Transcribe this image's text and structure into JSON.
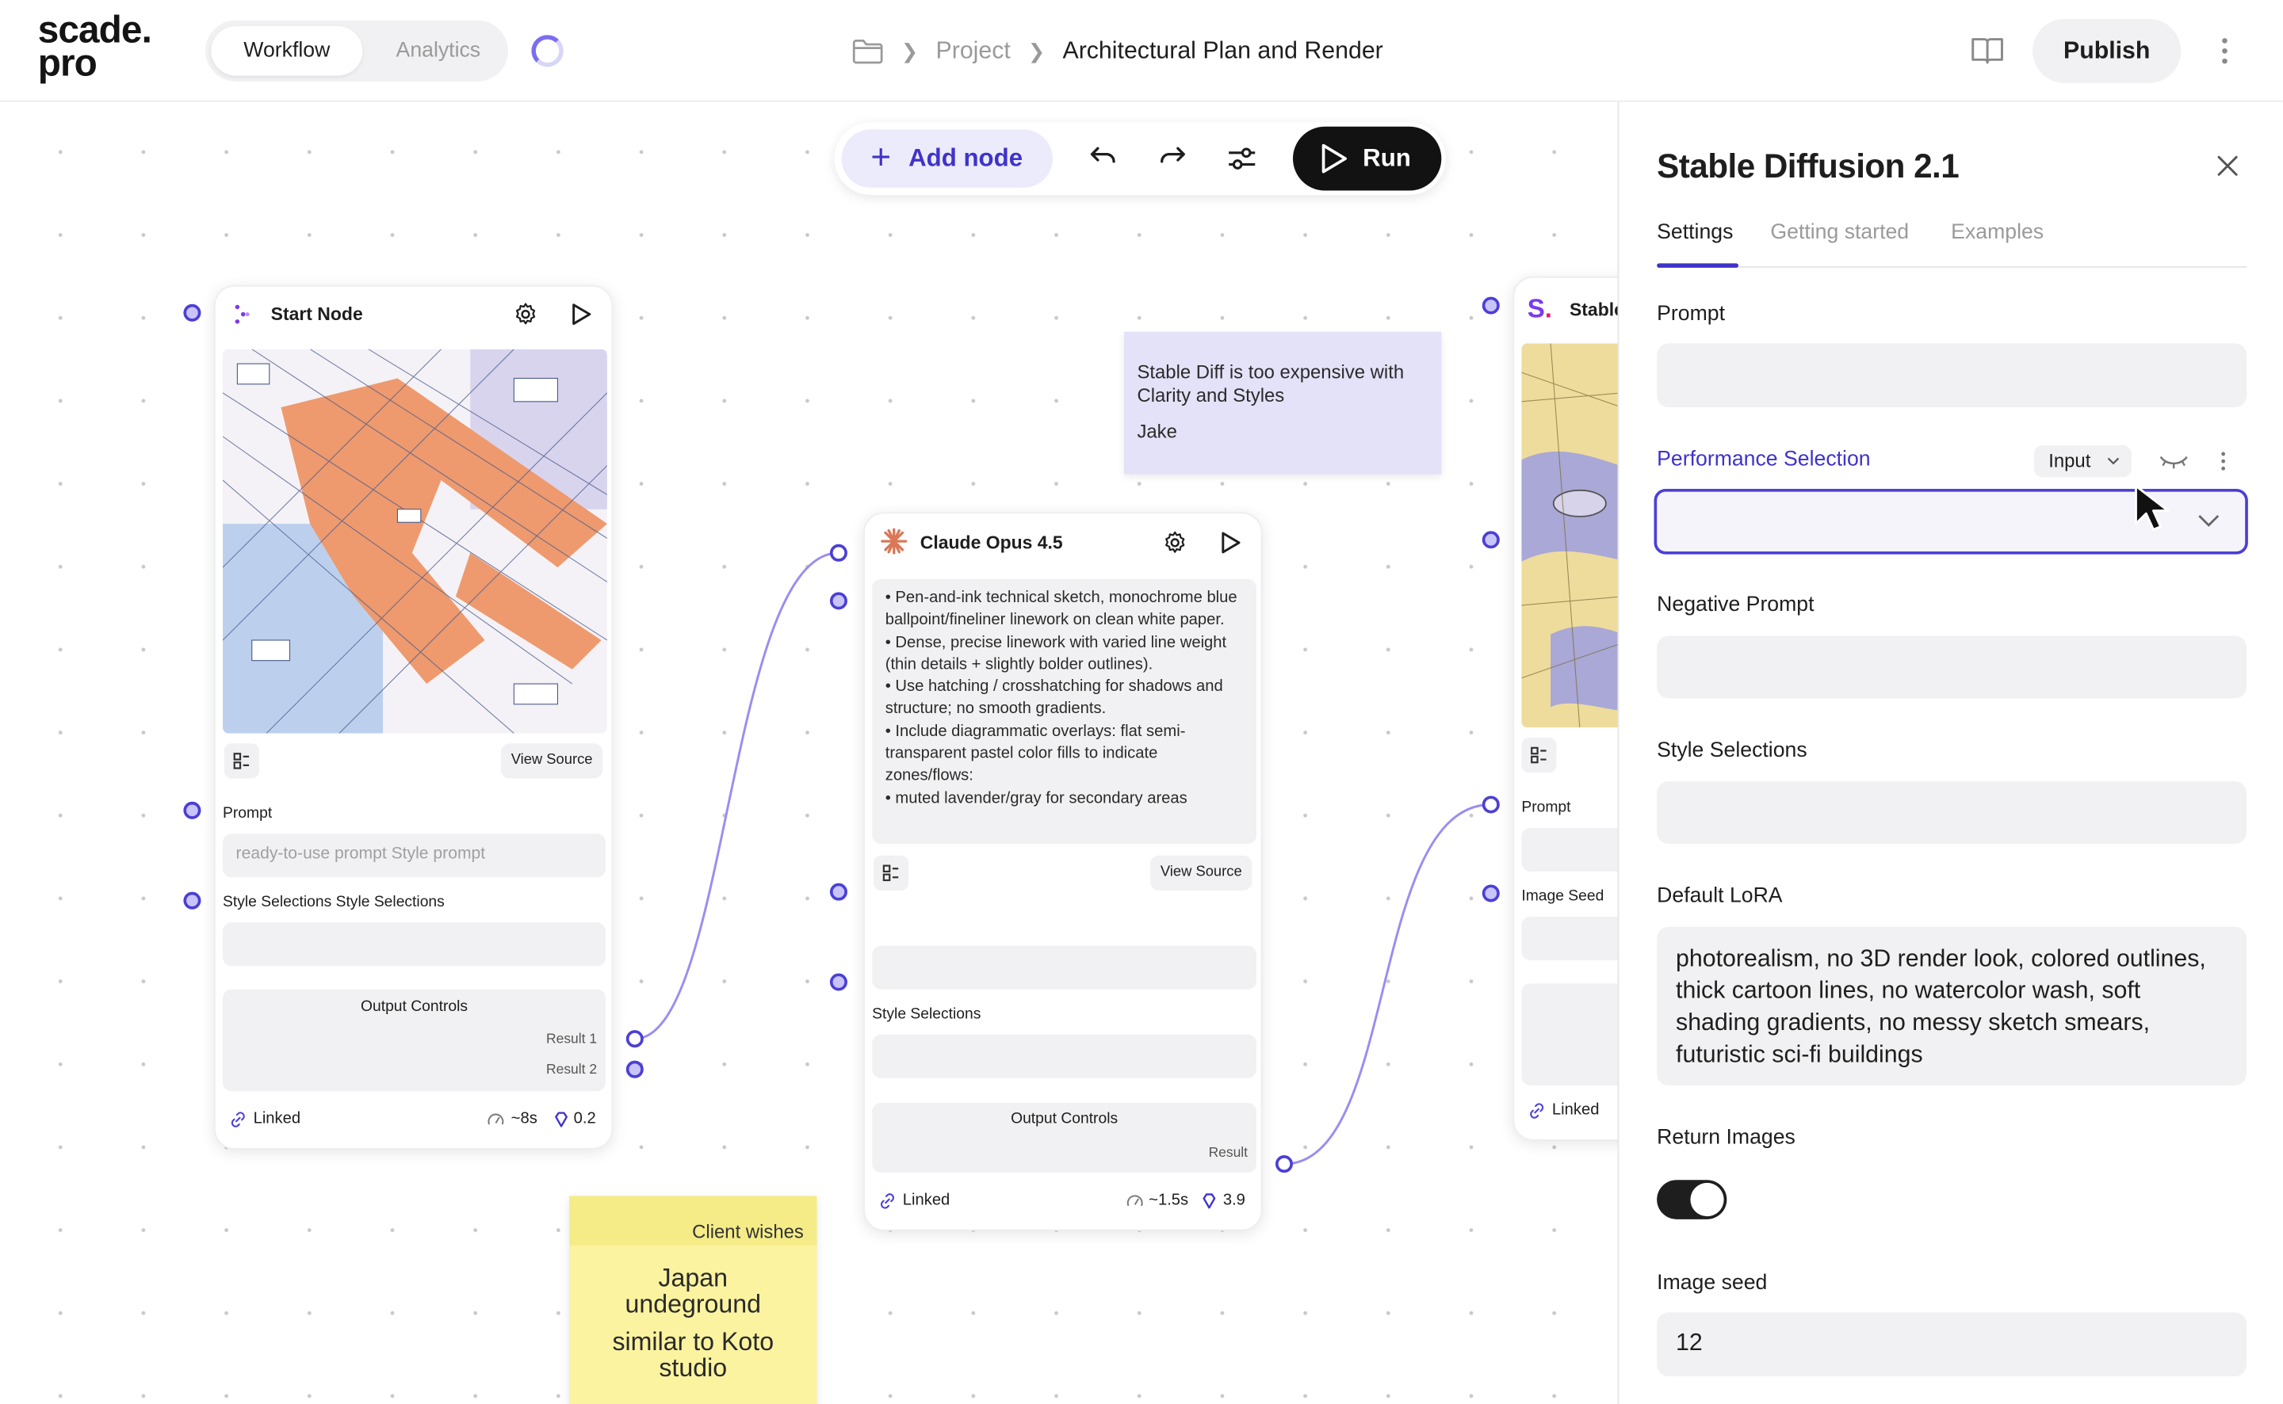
{
  "header": {
    "logo": [
      "scade.",
      "pro"
    ],
    "tabs": [
      {
        "label": "Workflow",
        "active": true
      },
      {
        "label": "Analytics",
        "active": false
      }
    ],
    "breadcrumb": {
      "project": "Project",
      "current": "Architectural Plan and Render"
    },
    "publish_label": "Publish"
  },
  "toolbar": {
    "add_node_label": "Add node",
    "run_label": "Run"
  },
  "nodes": {
    "start": {
      "title": "Start Node",
      "view_source": "View Source",
      "prompt_label": "Prompt",
      "prompt_placeholder": "ready-to-use prompt Style prompt",
      "style_label": "Style Selections Style Selections",
      "output_controls": "Output Controls",
      "result1": "Result 1",
      "result2": "Result 2",
      "linked": "Linked",
      "time": "~8s",
      "cost": "0.2"
    },
    "claude": {
      "title": "Claude Opus 4.5",
      "bullets": [
        "• Pen-and-ink technical sketch, monochrome blue ballpoint/fineliner linework on clean white paper.",
        "• Dense, precise linework with varied line weight (thin details + slightly bolder outlines).",
        "• Use hatching / crosshatching for shadows and structure; no smooth gradients.",
        "• Include diagrammatic overlays: flat semi-transparent pastel color fills to indicate zones/flows:",
        "• muted lavender/gray for secondary areas"
      ],
      "view_source": "View Source",
      "style_label": "Style Selections",
      "output_controls": "Output Controls",
      "result": "Result",
      "linked": "Linked",
      "time": "~1.5s",
      "cost": "3.9"
    },
    "stable": {
      "title": "Stable",
      "prompt_label": "Prompt",
      "seed_label": "Image Seed",
      "linked": "Linked"
    }
  },
  "stickies": {
    "purple": {
      "text": "Stable Diff is too expensive with Clarity and Styles",
      "author": "Jake"
    },
    "yellow": {
      "title": "Client wishes",
      "line1": "Japan undeground",
      "line2": "similar to Koto studio"
    }
  },
  "panel": {
    "title": "Stable Diffusion 2.1",
    "tabs": [
      "Settings",
      "Getting started",
      "Examples"
    ],
    "prompt_label": "Prompt",
    "performance_label": "Performance Selection",
    "input_pill": "Input",
    "negative_label": "Negative Prompt",
    "style_label": "Style Selections",
    "lora_label": "Default LoRA",
    "lora_value": "photorealism, no 3D render look, colored outlines, thick cartoon lines, no watercolor wash, soft shading gradients, no messy sketch smears, futuristic sci-fi buildings",
    "return_images_label": "Return Images",
    "return_images_on": true,
    "seed_label": "Image seed",
    "seed_value": "12"
  },
  "colors": {
    "accent": "#3f33c9",
    "port": "#4b3fd6",
    "edge": "#9b8df0",
    "sticky_purple": "#e4e2f8",
    "sticky_yellow": "#fbf39f"
  }
}
